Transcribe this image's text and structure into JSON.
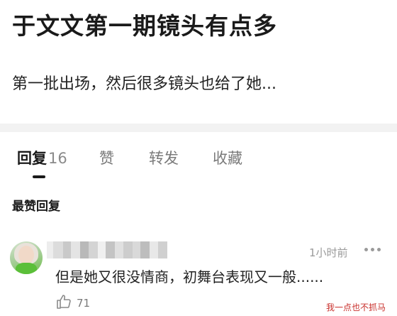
{
  "post": {
    "title": "于文文第一期镜头有点多",
    "body": "第一批出场，然后很多镜头也给了她..."
  },
  "tabs": [
    {
      "label": "回复",
      "count": "16",
      "active": true
    },
    {
      "label": "赞"
    },
    {
      "label": "转发"
    },
    {
      "label": "收藏"
    }
  ],
  "section_label": "最赞回复",
  "comment": {
    "time": "1小时前",
    "text": "但是她又很没情商，初舞台表现又一般......",
    "like_count": "71"
  },
  "icons": {
    "more": "more-dots-icon",
    "like": "thumbs-up-icon"
  },
  "colors": {
    "accent": "#1a1a1a",
    "muted": "#7a7a7a",
    "divider": "#f2f2f2",
    "watermark": "#c9302c"
  },
  "watermark": "我一点也不抓马"
}
